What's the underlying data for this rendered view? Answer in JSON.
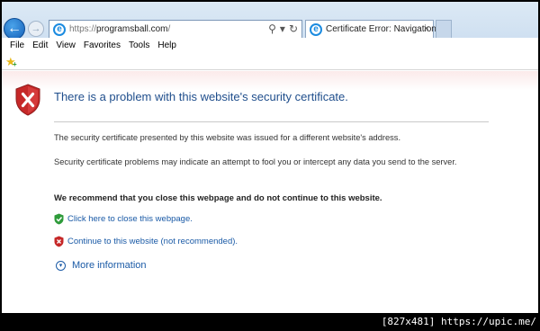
{
  "browser": {
    "url_host": "programsball.com",
    "url_prefix": "https://",
    "url_suffix": "/",
    "tab_title": "Certificate Error: Navigation...",
    "tab_close_glyph": "×",
    "address_search_glyph": "⚲",
    "address_dropdown_glyph": "▾",
    "address_refresh_glyph": "↻",
    "back_glyph": "←",
    "forward_glyph": "→"
  },
  "menu": {
    "items": [
      "File",
      "Edit",
      "View",
      "Favorites",
      "Tools",
      "Help"
    ]
  },
  "page": {
    "heading": "There is a problem with this website's security certificate.",
    "para1": "The security certificate presented by this website was issued for a different website's address.",
    "para2": "Security certificate problems may indicate an attempt to fool you or intercept any data you send to the server.",
    "recommend": "We recommend that you close this webpage and do not continue to this website.",
    "close_link": "Click here to close this webpage.",
    "continue_link": "Continue to this website (not recommended).",
    "more_info": "More information",
    "more_info_glyph": "▾"
  },
  "footer": {
    "text": "[827x481] https://upic.me/"
  },
  "colors": {
    "link": "#1a5aa6",
    "heading": "#1f4e8c",
    "shield_red": "#c62828",
    "shield_green": "#2e9b3a"
  }
}
